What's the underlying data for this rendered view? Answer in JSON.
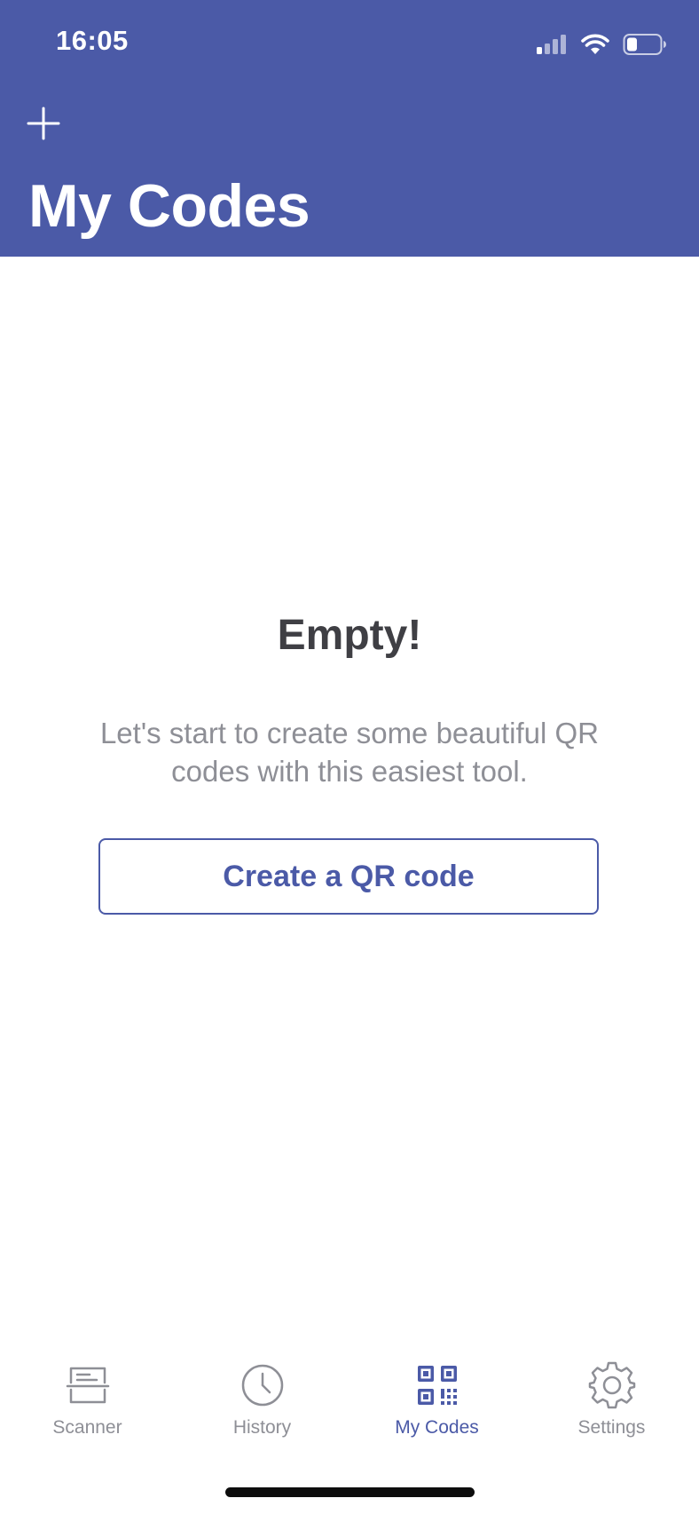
{
  "status_bar": {
    "time": "16:05",
    "icons": [
      "cellular-signal-icon",
      "wifi-icon",
      "battery-icon"
    ]
  },
  "header": {
    "add_icon": "plus-icon",
    "title": "My Codes"
  },
  "empty_state": {
    "title": "Empty!",
    "description": "Let's start to create some beautiful QR codes with this easiest tool.",
    "button_label": "Create a QR code"
  },
  "tabbar": {
    "tabs": [
      {
        "label": "Scanner",
        "icon": "scanner-icon",
        "active": false
      },
      {
        "label": "History",
        "icon": "clock-icon",
        "active": false
      },
      {
        "label": "My Codes",
        "icon": "qr-code-icon",
        "active": true
      },
      {
        "label": "Settings",
        "icon": "gear-icon",
        "active": false
      }
    ]
  },
  "colors": {
    "brand": "#4b5aa7",
    "inactive": "#8e8f96",
    "title_text": "#3f3f44"
  }
}
